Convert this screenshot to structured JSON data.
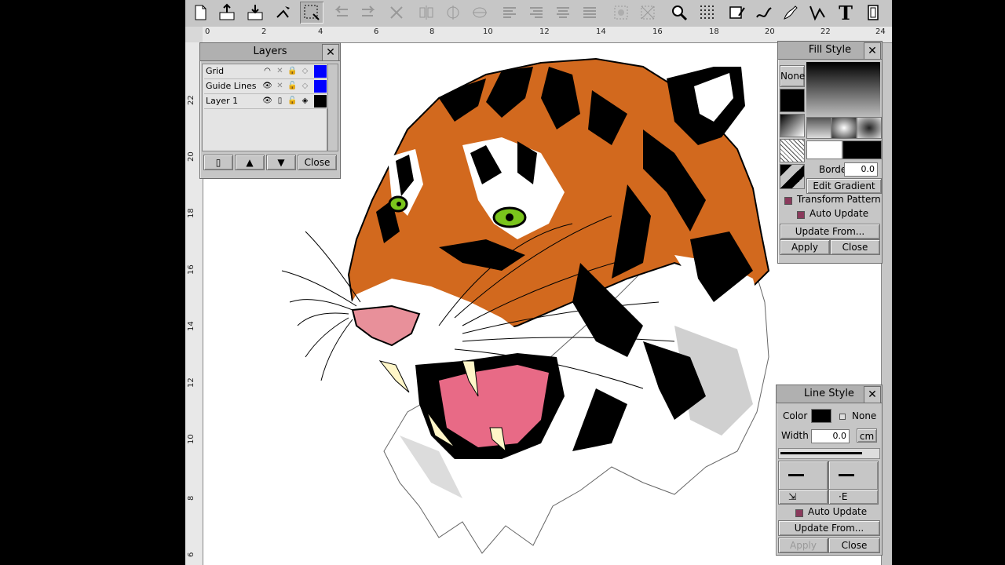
{
  "toolbar": {
    "icons": [
      "new-document",
      "import",
      "export",
      "node-edit",
      "select-region",
      "undo",
      "redo",
      "delete",
      "align-left",
      "align-center",
      "align-middle",
      "justify-1",
      "justify-2",
      "justify-3",
      "justify-4",
      "group",
      "ungroup",
      "zoom",
      "grid",
      "rectangle-tool",
      "freehand-tool",
      "pen-tool",
      "polyline-tool",
      "text-tool",
      "page-tool"
    ],
    "text_tool_label": "T"
  },
  "rulers": {
    "top": [
      "0",
      "2",
      "4",
      "6",
      "8",
      "10",
      "12",
      "14",
      "16",
      "18",
      "20",
      "22",
      "24"
    ],
    "left": [
      "22",
      "20",
      "18",
      "16",
      "14",
      "12",
      "10",
      "8",
      "6"
    ]
  },
  "layers_panel": {
    "title": "Layers",
    "close_glyph": "✕",
    "layers": [
      {
        "name": "Grid",
        "color": "#0000ff"
      },
      {
        "name": "Guide Lines",
        "color": "#0000ff"
      },
      {
        "name": "Layer 1",
        "color": "#000000"
      }
    ],
    "close_label": "Close"
  },
  "fill_style_panel": {
    "title": "Fill Style",
    "close_glyph": "✕",
    "none_label": "None",
    "border_label": "Border",
    "border_value": "0.0",
    "edit_gradient_label": "Edit Gradient",
    "transform_pattern_label": "Transform Pattern",
    "auto_update_label": "Auto Update",
    "update_from_label": "Update From...",
    "apply_label": "Apply",
    "close_label": "Close"
  },
  "line_style_panel": {
    "title": "Line Style",
    "close_glyph": "✕",
    "color_label": "Color",
    "none_label": "None",
    "width_label": "Width",
    "width_value": "0.0",
    "unit_label": "cm",
    "auto_update_label": "Auto Update",
    "update_from_label": "Update From...",
    "apply_label": "Apply",
    "close_label": "Close"
  },
  "colors": {
    "accent_checkbox": "#8a3a5c",
    "tiger_orange": "#d2691e",
    "tiger_eye": "#7ac41c",
    "mouth": "#e86a86"
  }
}
